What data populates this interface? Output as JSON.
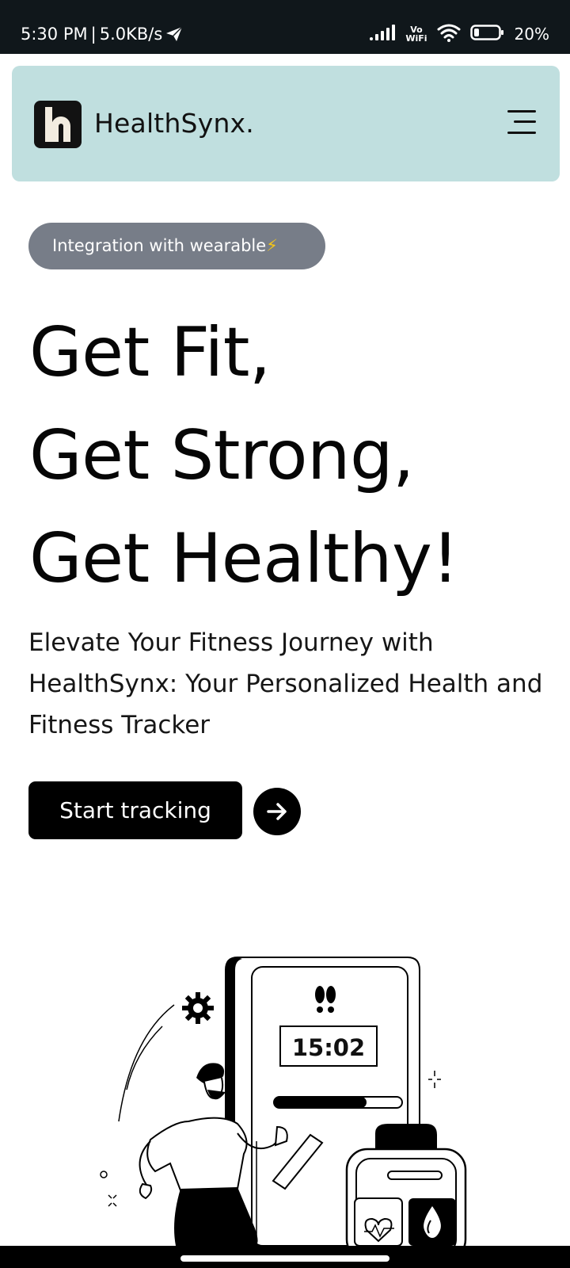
{
  "status_bar": {
    "time": "5:30 PM",
    "speed": "5.0KB/s",
    "wifi_label_top": "Vo",
    "wifi_label_bottom": "WiFi",
    "battery": "20%",
    "icons": [
      "telegram-icon",
      "signal-icon",
      "vowifi-icon",
      "wifi-icon",
      "battery-icon"
    ]
  },
  "header": {
    "brand": "HealthSynx.",
    "logo_icon": "h-logo-icon",
    "menu_icon": "hamburger-menu-icon",
    "background": "#c0dfdf"
  },
  "badge": {
    "label": "Integration with wearable",
    "emoji": "⚡"
  },
  "hero": {
    "lines": [
      "Get Fit,",
      "Get Strong,",
      "Get Healthy!"
    ],
    "subtitle": "Elevate Your Fitness Journey with HealthSynx: Your Personalized Health and Fitness Tracker"
  },
  "cta": {
    "label": "Start tracking",
    "arrow_icon": "arrow-right-icon"
  },
  "illustration": {
    "timer": "15:02",
    "progress": 0.72,
    "icons": [
      "footsteps-icon",
      "gear-icon",
      "heart-rate-icon",
      "water-drop-icon"
    ]
  },
  "colors": {
    "status_bar": "#10171b",
    "badge": "#777d88",
    "cta": "#000000"
  }
}
